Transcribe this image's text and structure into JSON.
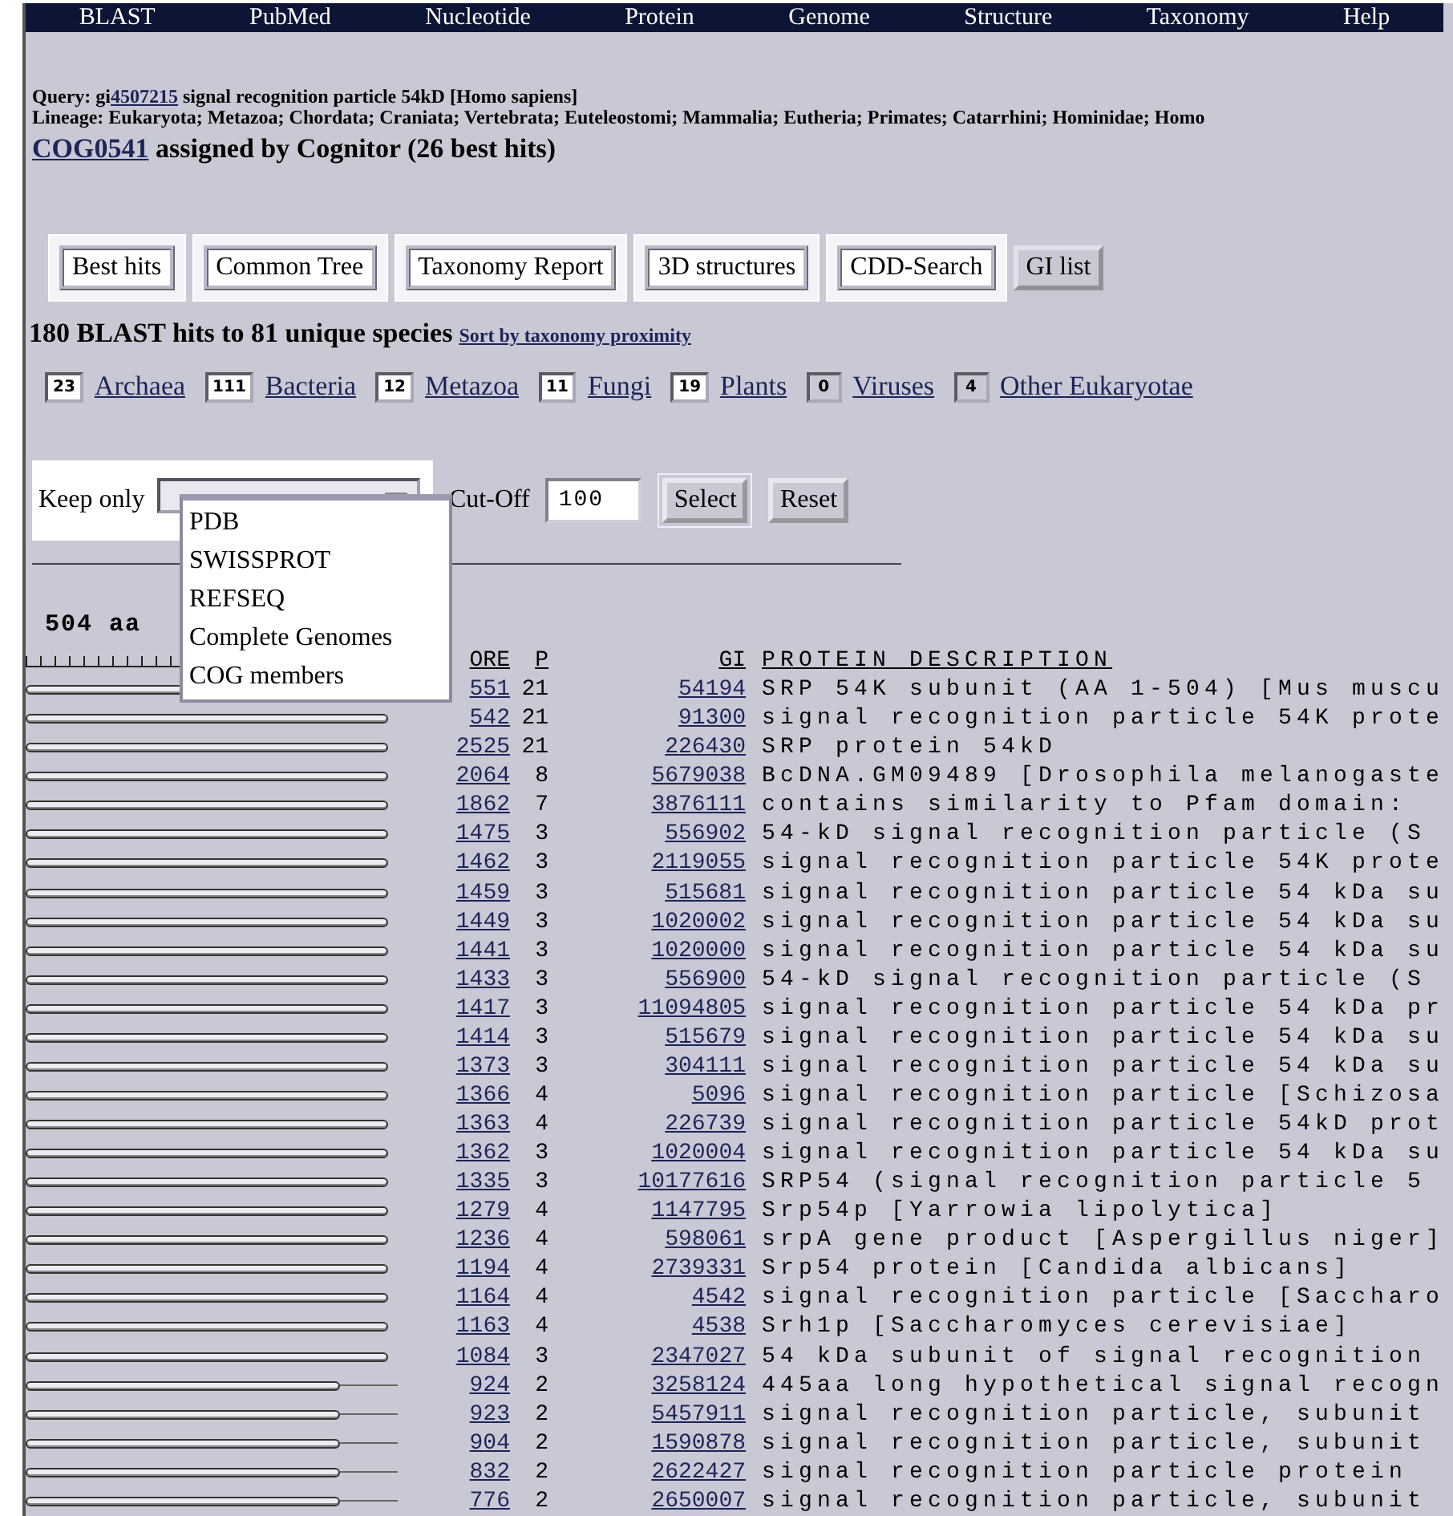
{
  "nav": [
    "BLAST",
    "PubMed",
    "Nucleotide",
    "Protein",
    "Genome",
    "Structure",
    "Taxonomy",
    "Help"
  ],
  "query": {
    "label": "Query: gi",
    "gi": "4507215",
    "description": "signal recognition particle 54kD [Homo sapiens]",
    "lineage": "Lineage: Eukaryota; Metazoa; Chordata; Craniata; Vertebrata; Euteleostomi; Mammalia; Eutheria; Primates; Catarrhini; Hominidae; Homo",
    "cog": "COG0541",
    "cog_text": "assigned by Cognitor (26 best hits)"
  },
  "tool_buttons": [
    {
      "label": "Best hits",
      "framed": true
    },
    {
      "label": "Common Tree",
      "framed": true
    },
    {
      "label": "Taxonomy Report",
      "framed": true
    },
    {
      "label": "3D structures",
      "framed": true
    },
    {
      "label": "CDD-Search",
      "framed": true
    },
    {
      "label": "GI list",
      "framed": false
    }
  ],
  "summary": {
    "text": "180 BLAST hits to 81 unique species",
    "sort_link": "Sort by taxonomy proximity"
  },
  "species": [
    {
      "count": "23",
      "name": "Archaea",
      "highlighted": true
    },
    {
      "count": "111",
      "name": "Bacteria",
      "highlighted": true
    },
    {
      "count": "12",
      "name": "Metazoa",
      "highlighted": true
    },
    {
      "count": "11",
      "name": "Fungi",
      "highlighted": true
    },
    {
      "count": "19",
      "name": "Plants",
      "highlighted": true
    },
    {
      "count": "0",
      "name": "Viruses",
      "highlighted": false
    },
    {
      "count": "4",
      "name": "Other Eukaryotae",
      "highlighted": false
    }
  ],
  "filter": {
    "label": "Keep only",
    "options": [
      "PDB",
      "SWISSPROT",
      "REFSEQ",
      "Complete Genomes",
      "COG members"
    ],
    "expanded": true,
    "cutoff_label": "Cut-Off",
    "cutoff_value": "100",
    "buttons": [
      "Select",
      "Reset"
    ]
  },
  "hits": {
    "length": "504 aa",
    "columns": [
      "ORE",
      "P",
      "GI",
      "PROTEIN DESCRIPTION"
    ],
    "rows": [
      {
        "score": "551",
        "p": "21",
        "gi": "54194",
        "description": "SRP 54K subunit (AA 1-504) [Mus muscu",
        "kind": "full"
      },
      {
        "score": "542",
        "p": "21",
        "gi": "91300",
        "description": "signal recognition particle 54K prote",
        "kind": "full"
      },
      {
        "score": "2525",
        "p": "21",
        "gi": "226430",
        "description": "SRP protein 54kD",
        "kind": "full"
      },
      {
        "score": "2064",
        "p": "8",
        "gi": "5679038",
        "description": "BcDNA.GM09489 [Drosophila melanogaste",
        "kind": "full"
      },
      {
        "score": "1862",
        "p": "7",
        "gi": "3876111",
        "description": "contains similarity to Pfam domain:",
        "kind": "full"
      },
      {
        "score": "1475",
        "p": "3",
        "gi": "556902",
        "description": "54-kD signal recognition particle (S",
        "kind": "full"
      },
      {
        "score": "1462",
        "p": "3",
        "gi": "2119055",
        "description": "signal recognition particle 54K prote",
        "kind": "full"
      },
      {
        "score": "1459",
        "p": "3",
        "gi": "515681",
        "description": "signal recognition particle 54 kDa su",
        "kind": "full"
      },
      {
        "score": "1449",
        "p": "3",
        "gi": "1020002",
        "description": "signal recognition particle 54 kDa su",
        "kind": "full"
      },
      {
        "score": "1441",
        "p": "3",
        "gi": "1020000",
        "description": "signal recognition particle 54 kDa su",
        "kind": "full"
      },
      {
        "score": "1433",
        "p": "3",
        "gi": "556900",
        "description": "54-kD signal recognition particle (S",
        "kind": "full"
      },
      {
        "score": "1417",
        "p": "3",
        "gi": "11094805",
        "description": "signal recognition particle 54 kDa pr",
        "kind": "full"
      },
      {
        "score": "1414",
        "p": "3",
        "gi": "515679",
        "description": "signal recognition particle 54 kDa su",
        "kind": "full"
      },
      {
        "score": "1373",
        "p": "3",
        "gi": "304111",
        "description": "signal recognition particle 54 kDa su",
        "kind": "full"
      },
      {
        "score": "1366",
        "p": "4",
        "gi": "5096",
        "description": "signal recognition particle [Schizosa",
        "kind": "full"
      },
      {
        "score": "1363",
        "p": "4",
        "gi": "226739",
        "description": "signal recognition particle 54kD prot",
        "kind": "full"
      },
      {
        "score": "1362",
        "p": "3",
        "gi": "1020004",
        "description": "signal recognition particle 54 kDa su",
        "kind": "full"
      },
      {
        "score": "1335",
        "p": "3",
        "gi": "10177616",
        "description": "SRP54 (signal recognition particle 5",
        "kind": "full"
      },
      {
        "score": "1279",
        "p": "4",
        "gi": "1147795",
        "description": "Srp54p [Yarrowia lipolytica]",
        "kind": "full"
      },
      {
        "score": "1236",
        "p": "4",
        "gi": "598061",
        "description": "srpA gene product [Aspergillus niger]",
        "kind": "full"
      },
      {
        "score": "1194",
        "p": "4",
        "gi": "2739331",
        "description": "Srp54 protein [Candida albicans]",
        "kind": "full"
      },
      {
        "score": "1164",
        "p": "4",
        "gi": "4542",
        "description": "signal recognition particle [Saccharo",
        "kind": "full"
      },
      {
        "score": "1163",
        "p": "4",
        "gi": "4538",
        "description": "Srh1p [Saccharomyces cerevisiae]",
        "kind": "full"
      },
      {
        "score": "1084",
        "p": "3",
        "gi": "2347027",
        "description": "54 kDa subunit of signal recognition",
        "kind": "full"
      },
      {
        "score": "924",
        "p": "2",
        "gi": "3258124",
        "description": "445aa long hypothetical signal recogn",
        "kind": "partial"
      },
      {
        "score": "923",
        "p": "2",
        "gi": "5457911",
        "description": "signal recognition particle, subunit",
        "kind": "partial"
      },
      {
        "score": "904",
        "p": "2",
        "gi": "1590878",
        "description": "signal recognition particle, subunit",
        "kind": "partial"
      },
      {
        "score": "832",
        "p": "2",
        "gi": "2622427",
        "description": "signal recognition particle protein",
        "kind": "partial"
      },
      {
        "score": "776",
        "p": "2",
        "gi": "2650007",
        "description": "signal recognition particle, subunit",
        "kind": "partial"
      }
    ]
  }
}
